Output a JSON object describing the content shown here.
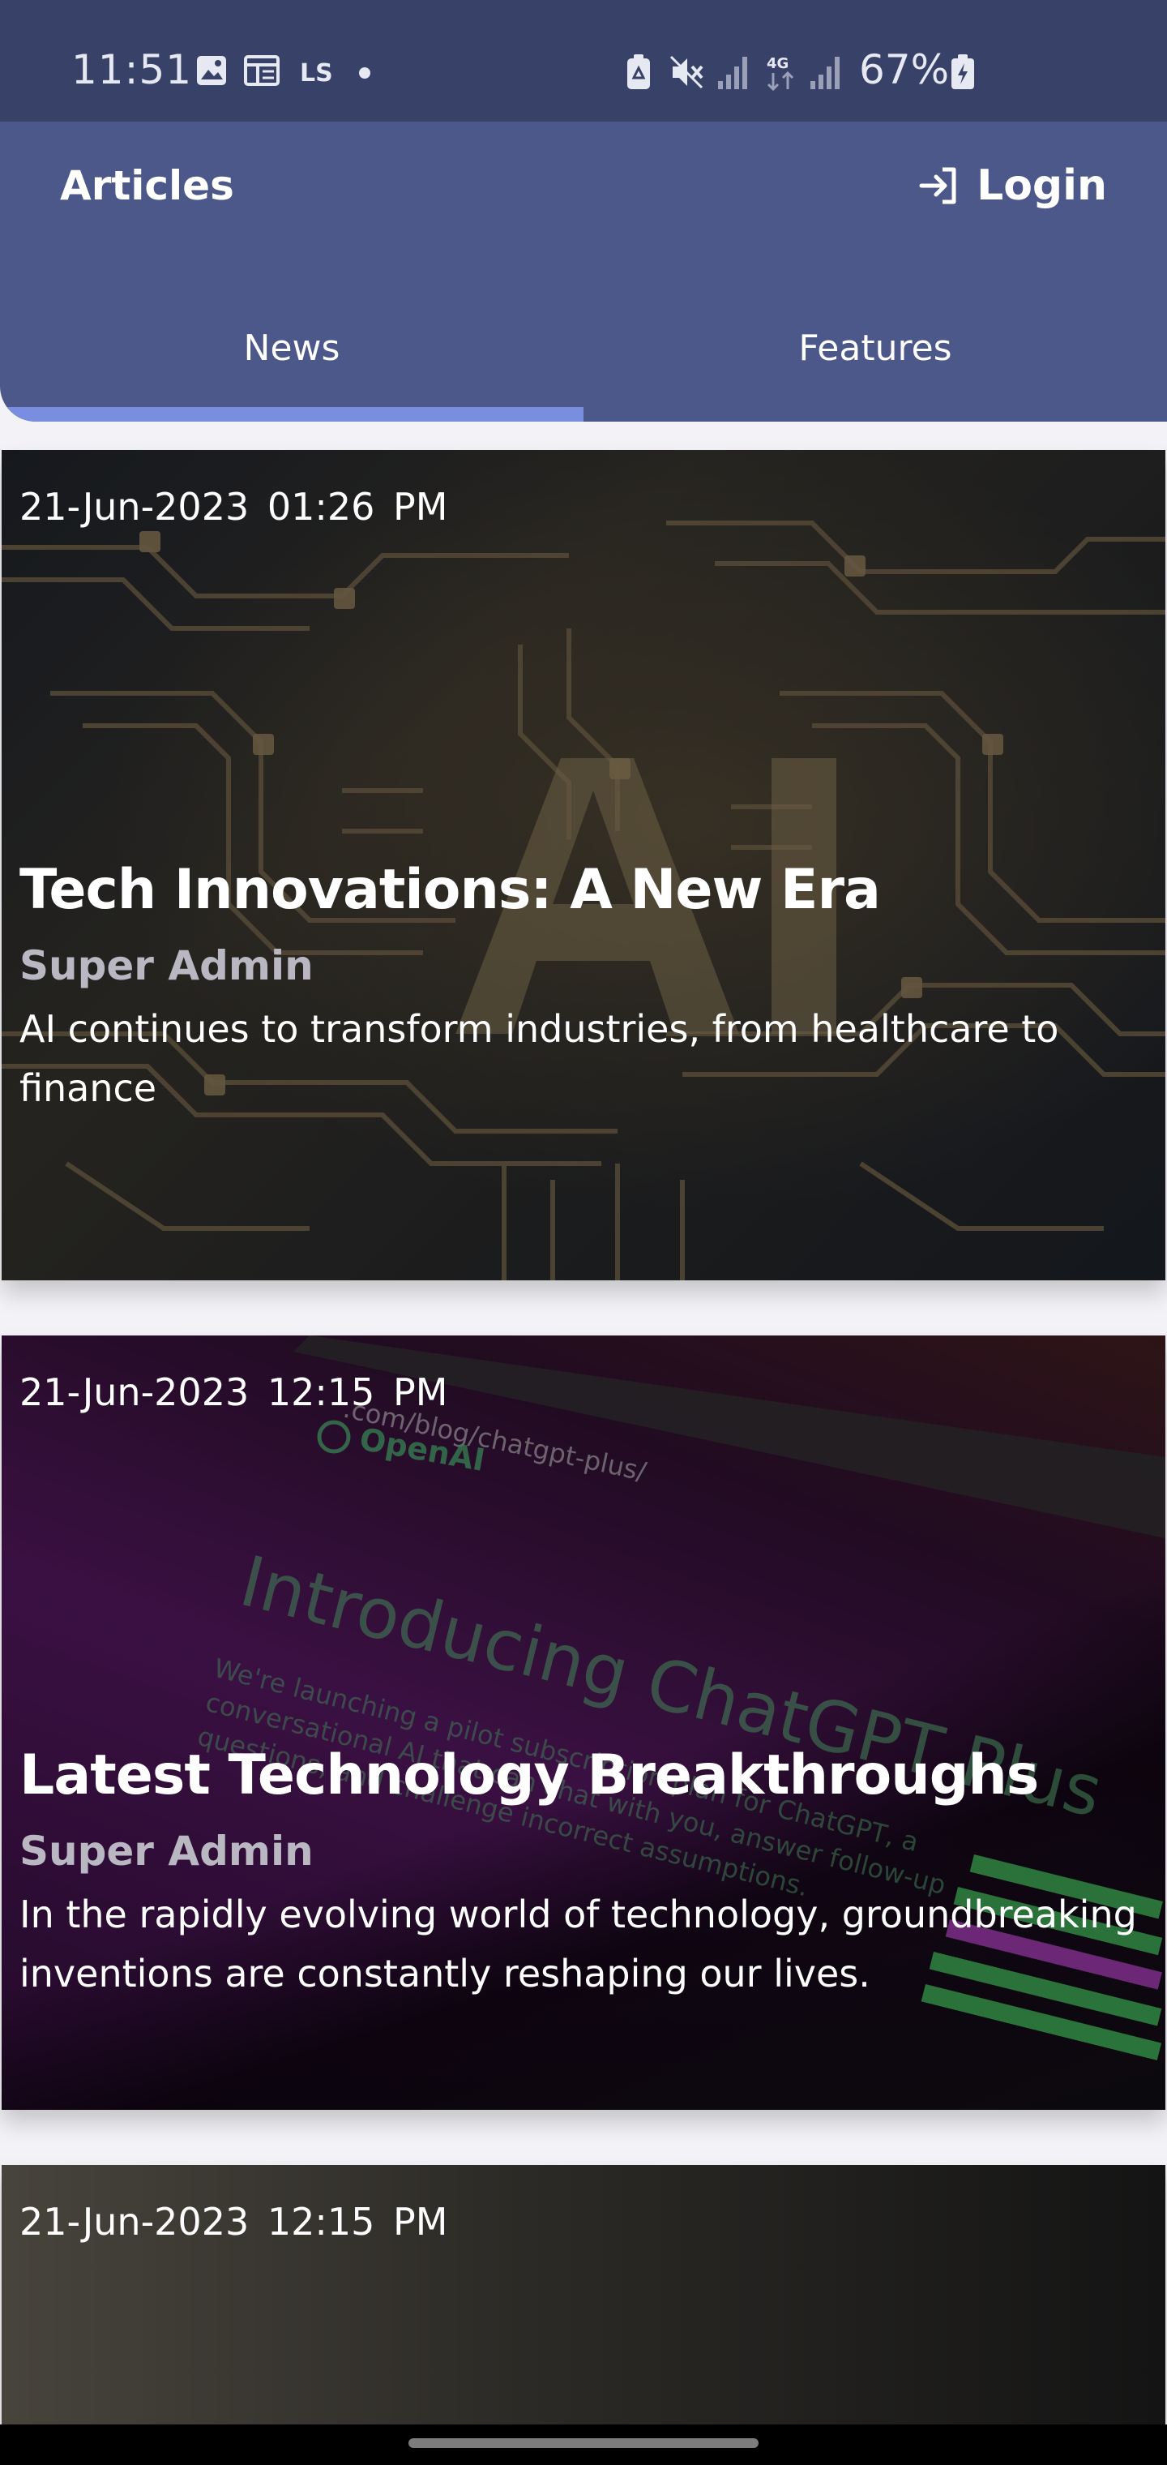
{
  "status_bar": {
    "time": "11:51",
    "battery": "67%",
    "network_label": "4G",
    "carrier_icon": "LS",
    "icons": [
      "gallery-icon",
      "news-widget-icon",
      "carrier-icon",
      "dot-icon",
      "battery-saver-icon",
      "mute-icon",
      "signal-icon",
      "network-4g-icon",
      "signal-icon",
      "battery-icon"
    ]
  },
  "app_bar": {
    "title": "Articles",
    "login_label": "Login",
    "login_icon": "login-icon",
    "color": "#4b5889"
  },
  "tabs": [
    {
      "label": "News",
      "selected": true
    },
    {
      "label": "Features",
      "selected": false
    }
  ],
  "accent_color": "#7a8ee0",
  "articles": [
    {
      "date": "21-Jun-2023  01:26 PM",
      "title": "Tech Innovations: A New Era",
      "author": "Super Admin",
      "description": "AI continues to transform industries, from healthcare to finance",
      "image_overlay_text": "AI"
    },
    {
      "date": "21-Jun-2023  12:15 PM",
      "title": "Latest Technology Breakthroughs",
      "author": "Super Admin",
      "description": "In the rapidly evolving world of technology, groundbreaking inventions are constantly reshaping our lives.",
      "image_overlay_text": {
        "url": ".com/blog/chatgpt-plus/",
        "brand": "OpenAI",
        "heading": "Introducing ChatGPT Plus",
        "line1": "We're launching a pilot subscription plan for ChatGPT, a",
        "line2": "conversational AI that can chat with you, answer follow-up",
        "line3": "questions, and challenge incorrect assumptions."
      }
    },
    {
      "date": "21-Jun-2023  12:15 PM"
    }
  ]
}
